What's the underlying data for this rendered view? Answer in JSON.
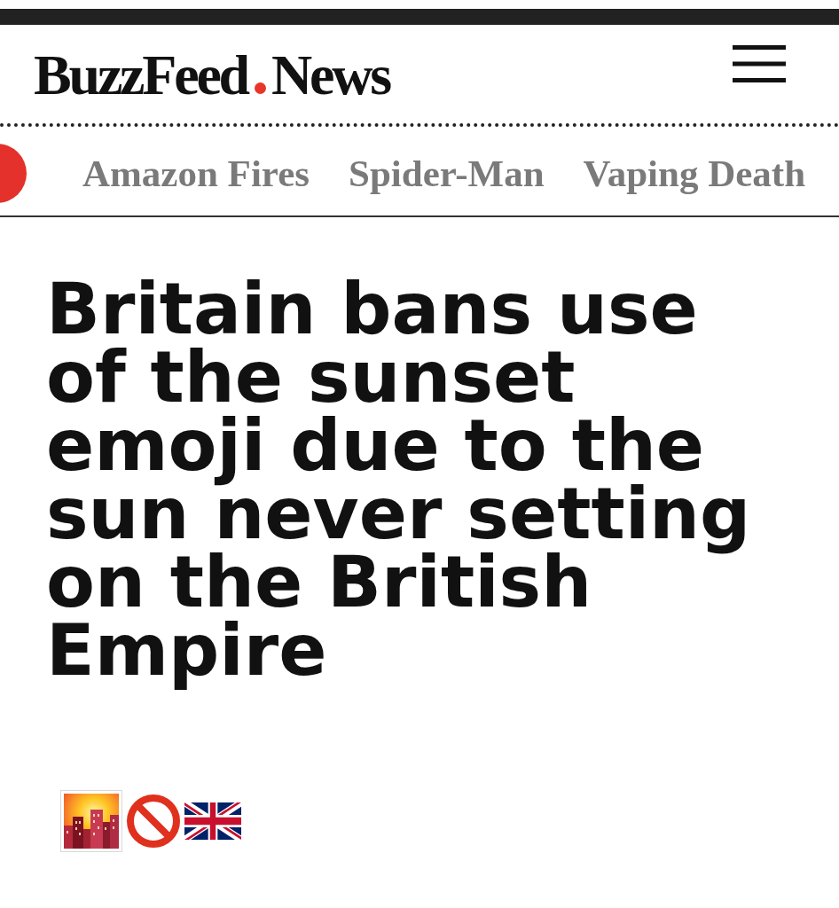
{
  "header": {
    "logo": {
      "brand": "BuzzFeed",
      "section": "News"
    }
  },
  "nav": {
    "items": [
      {
        "label": "Amazon Fires"
      },
      {
        "label": "Spider-Man"
      },
      {
        "label": "Vaping Death"
      }
    ]
  },
  "article": {
    "headline": "Britain bans use of the sunset emoji due to the sun never setting on the British Empire"
  }
}
